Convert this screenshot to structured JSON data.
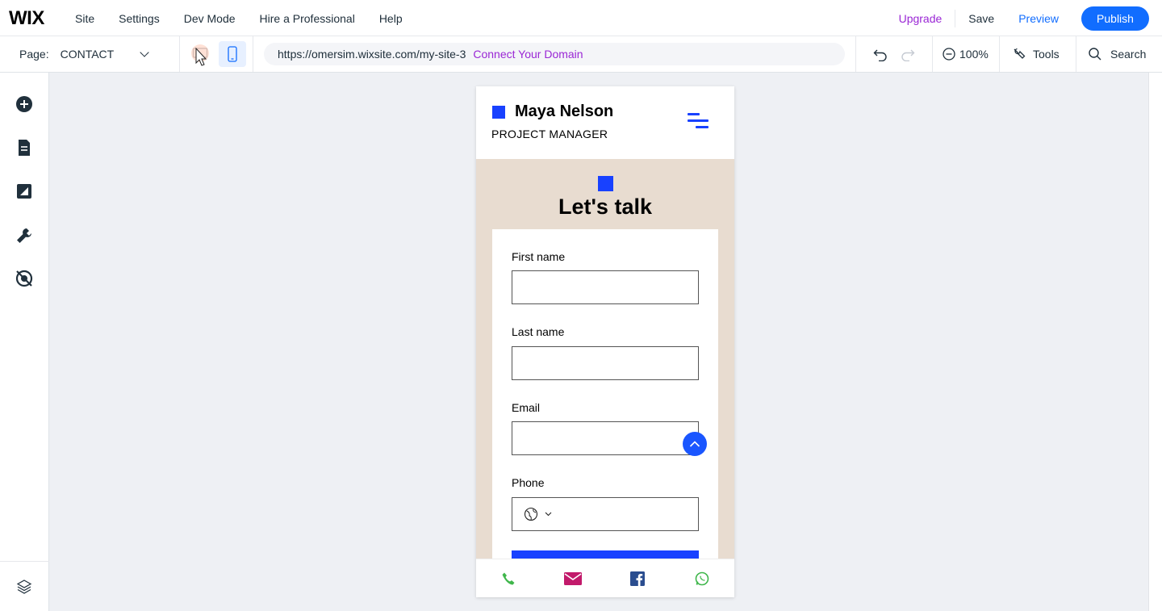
{
  "topbar": {
    "logo": "WIX",
    "menu": [
      "Site",
      "Settings",
      "Dev Mode",
      "Hire a Professional",
      "Help"
    ],
    "upgrade": "Upgrade",
    "save": "Save",
    "preview": "Preview",
    "publish": "Publish"
  },
  "secondbar": {
    "page_label": "Page:",
    "page_value": "CONTACT",
    "url": "https://omersim.wixsite.com/my-site-3",
    "connect_domain": "Connect Your Domain",
    "zoom": "100%",
    "tools": "Tools",
    "search": "Search"
  },
  "mobile": {
    "name": "Maya Nelson",
    "role": "PROJECT MANAGER",
    "title": "Let's talk",
    "form": {
      "first_name": "First name",
      "last_name": "Last name",
      "email": "Email",
      "phone": "Phone"
    }
  },
  "colors": {
    "accent": "#116dff",
    "upgrade": "#9a27d5",
    "brand_blue": "#1841ff",
    "section_bg": "#e8dcd0",
    "canvas_bg": "#eef0f4"
  }
}
